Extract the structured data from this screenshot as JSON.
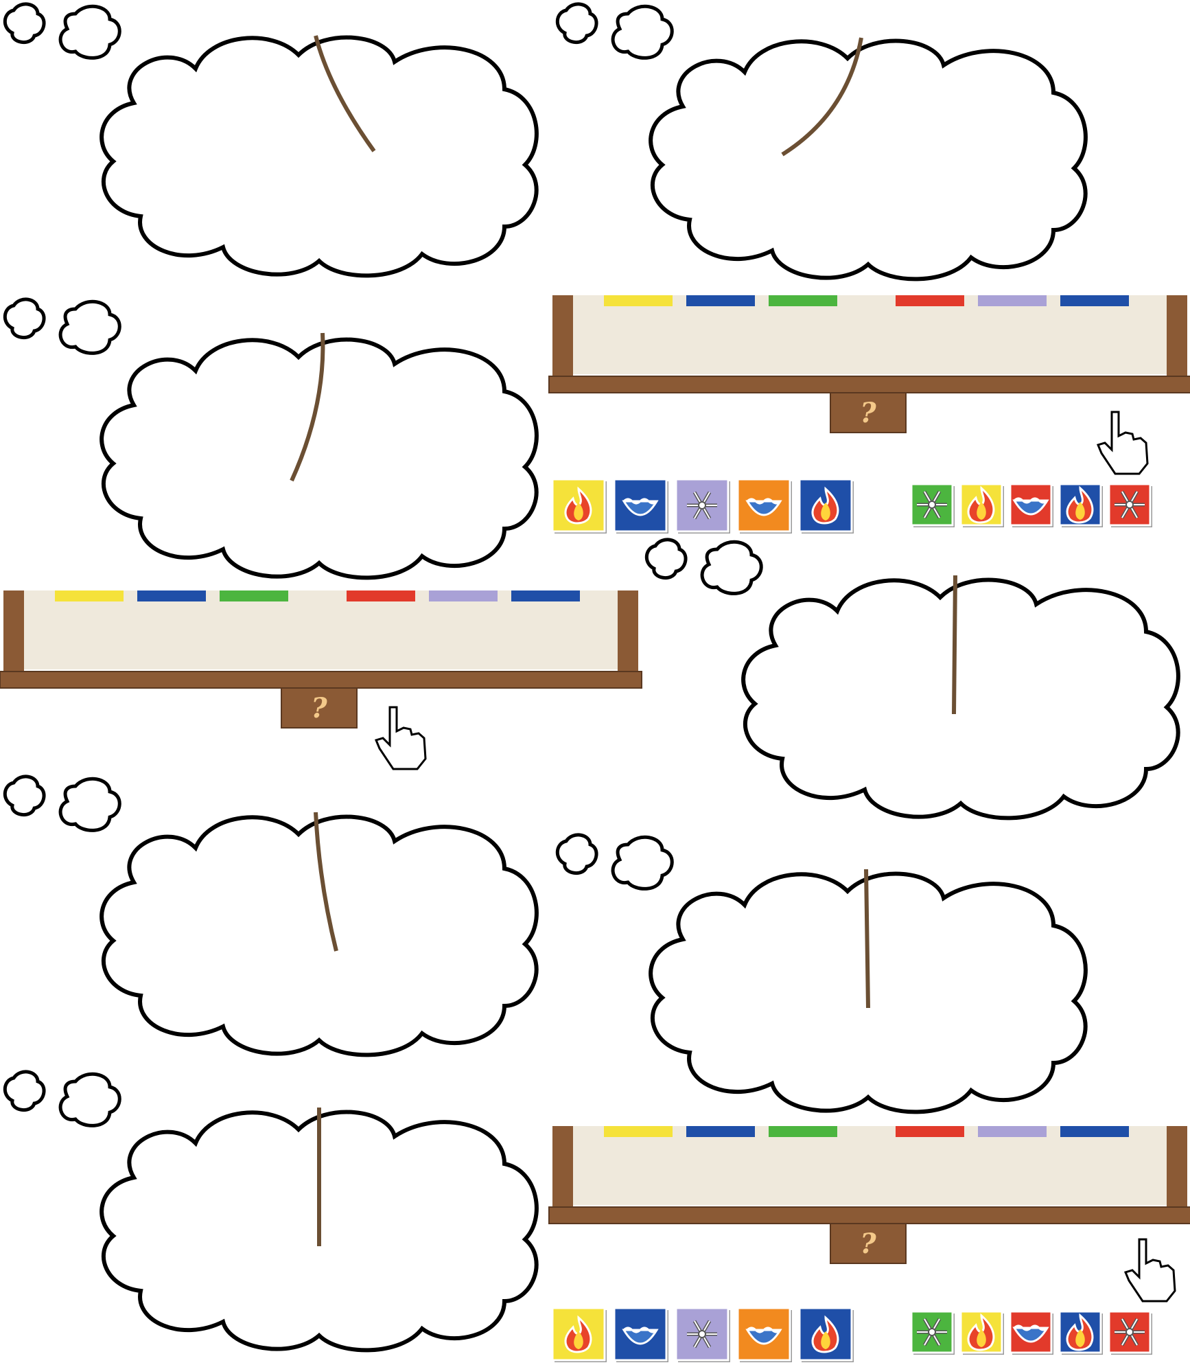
{
  "board": {
    "help_label": "?",
    "strip_colors": [
      "#f5e23a",
      "#1f4fa8",
      "#4cb53f",
      "#e23a2b",
      "#a9a1d6",
      "#1f4fa8"
    ]
  },
  "colors": {
    "wood": "#8b5a35",
    "wood_dark": "#5a3820",
    "board_face": "#efe9dc",
    "stem": "#6b4f33",
    "outline": "#000000"
  },
  "tiles": {
    "row_a": [
      {
        "bg": "#f5e23a",
        "icon": "fire-icon"
      },
      {
        "bg": "#1f4fa8",
        "icon": "water-icon"
      },
      {
        "bg": "#a9a1d6",
        "icon": "snowflake-icon"
      },
      {
        "bg": "#f28a1f",
        "icon": "water-icon"
      },
      {
        "bg": "#1f4fa8",
        "icon": "fire-icon"
      }
    ],
    "row_b": [
      {
        "bg": "#4cb53f",
        "icon": "snowflake-icon"
      },
      {
        "bg": "#f5e23a",
        "icon": "fire-icon"
      },
      {
        "bg": "#e23a2b",
        "icon": "water-icon"
      },
      {
        "bg": "#1f4fa8",
        "icon": "fire-icon"
      },
      {
        "bg": "#e23a2b",
        "icon": "snowflake-icon"
      }
    ]
  }
}
